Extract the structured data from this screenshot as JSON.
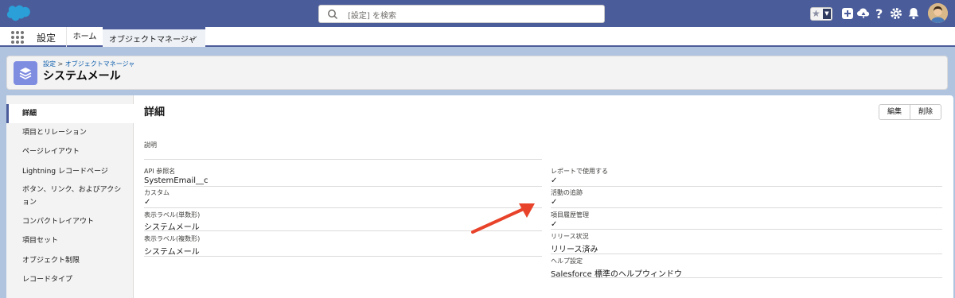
{
  "header": {
    "search_placeholder": "[設定] を検索"
  },
  "nav": {
    "app_name": "設定",
    "tab_home": "ホーム",
    "tab_object_manager": "オブジェクトマネージャ"
  },
  "page": {
    "breadcrumb_setup": "設定",
    "breadcrumb_sep": " > ",
    "breadcrumb_om": "オブジェクトマネージャ",
    "title": "システムメール"
  },
  "sidebar": {
    "items": [
      {
        "label": "詳細"
      },
      {
        "label": "項目とリレーション"
      },
      {
        "label": "ページレイアウト"
      },
      {
        "label": "Lightning レコードページ"
      },
      {
        "label": "ボタン、リンク、およびアクション"
      },
      {
        "label": "コンパクトレイアウト"
      },
      {
        "label": "項目セット"
      },
      {
        "label": "オブジェクト制限"
      },
      {
        "label": "レコードタイプ"
      }
    ]
  },
  "detail": {
    "title": "詳細",
    "edit_label": "編集",
    "delete_label": "削除",
    "description_label": "説明",
    "api_name_label": "API 参照名",
    "api_name_value": "SystemEmail__c",
    "custom_label": "カスタム",
    "singular_label": "表示ラベル(単数形)",
    "singular_value": "システムメール",
    "plural_label": "表示ラベル(複数形)",
    "plural_value": "システムメール",
    "reports_label": "レポートで使用する",
    "activities_label": "活動の追跡",
    "history_label": "項目履歴管理",
    "release_label": "リリース状況",
    "release_value": "リリース済み",
    "help_label": "ヘルプ設定",
    "help_value": "Salesforce 標準のヘルプウィンドウ"
  },
  "colors": {
    "header_bg": "#4b5c9a",
    "page_bg": "#b0c4df",
    "annotation_arrow": "#e8432a"
  }
}
